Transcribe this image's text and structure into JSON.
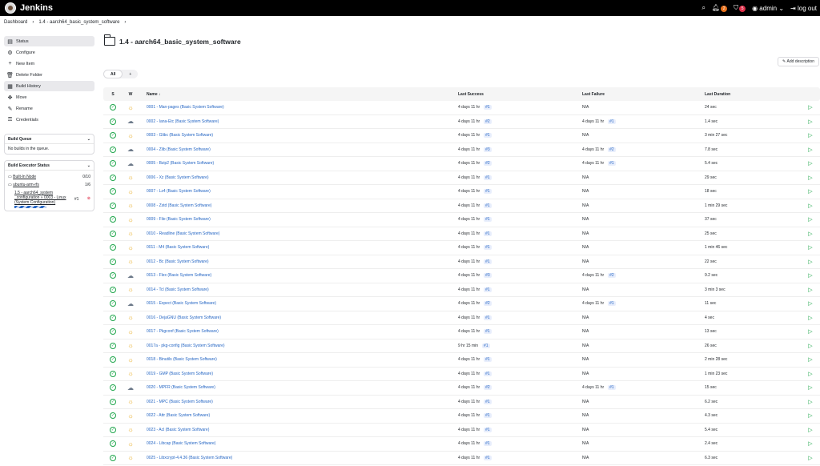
{
  "header": {
    "brand": "Jenkins",
    "notifications_count": "2",
    "security_count": "5",
    "user": "admin",
    "logout": "log out"
  },
  "breadcrumb": [
    "Dashboard",
    "1.4 - aarch64_basic_system_software"
  ],
  "sidebar": {
    "items": [
      {
        "label": "Status",
        "icon": "status-icon"
      },
      {
        "label": "Configure",
        "icon": "gear-icon"
      },
      {
        "label": "New Item",
        "icon": "plus-icon"
      },
      {
        "label": "Delete Folder",
        "icon": "trash-icon"
      },
      {
        "label": "Build History",
        "icon": "history-icon"
      },
      {
        "label": "Move",
        "icon": "move-icon"
      },
      {
        "label": "Rename",
        "icon": "pencil-icon"
      },
      {
        "label": "Credentials",
        "icon": "key-icon"
      }
    ],
    "build_queue": {
      "title": "Build Queue",
      "empty": "No builds in the queue."
    },
    "executor": {
      "title": "Build Executor Status",
      "nodes": [
        {
          "name": "Built-In Node",
          "count": "0/10"
        },
        {
          "name": "ubuntu-arm-rfs",
          "count": "1/6"
        }
      ],
      "job_line1": "1.5 - aarch64_system",
      "job_line2": "_configuration » 0003 - Linux",
      "job_line3": "(System Configuration)",
      "job_num": "#1"
    }
  },
  "main": {
    "title": "1.4 - aarch64_basic_system_software",
    "add_description": "Add description",
    "tabs": [
      "All",
      "+"
    ],
    "columns": {
      "s": "S",
      "w": "W",
      "name": "Name ↓",
      "last_success": "Last Success",
      "last_failure": "Last Failure",
      "last_duration": "Last Duration"
    },
    "rows": [
      {
        "name": "0001 - Man-pages (Basic System Software)",
        "weather": "sun",
        "succ": "4 days 11 hr",
        "succ_num": "#1",
        "fail": "N/A",
        "fail_num": "",
        "dur": "24 sec"
      },
      {
        "name": "0002 - Iana-Etc (Basic System Software)",
        "weather": "cloud",
        "succ": "4 days 11 hr",
        "succ_num": "#2",
        "fail": "4 days 11 hr",
        "fail_num": "#1",
        "dur": "1.4 sec"
      },
      {
        "name": "0003 - Glibc (Basic System Software)",
        "weather": "sun",
        "succ": "4 days 11 hr",
        "succ_num": "#1",
        "fail": "N/A",
        "fail_num": "",
        "dur": "3 min 27 sec"
      },
      {
        "name": "0004 - Zlib (Basic System Software)",
        "weather": "cloud",
        "succ": "4 days 11 hr",
        "succ_num": "#3",
        "fail": "4 days 11 hr",
        "fail_num": "#2",
        "dur": "7.8 sec"
      },
      {
        "name": "0005 - Bzip2 (Basic System Software)",
        "weather": "cloud",
        "succ": "4 days 11 hr",
        "succ_num": "#2",
        "fail": "4 days 11 hr",
        "fail_num": "#1",
        "dur": "5.4 sec"
      },
      {
        "name": "0006 - Xz (Basic System Software)",
        "weather": "sun",
        "succ": "4 days 11 hr",
        "succ_num": "#1",
        "fail": "N/A",
        "fail_num": "",
        "dur": "29 sec"
      },
      {
        "name": "0007 - Lz4 (Basic System Software)",
        "weather": "sun",
        "succ": "4 days 11 hr",
        "succ_num": "#1",
        "fail": "N/A",
        "fail_num": "",
        "dur": "18 sec"
      },
      {
        "name": "0008 - Zstd (Basic System Software)",
        "weather": "sun",
        "succ": "4 days 11 hr",
        "succ_num": "#1",
        "fail": "N/A",
        "fail_num": "",
        "dur": "1 min 29 sec"
      },
      {
        "name": "0009 - File (Basic System Software)",
        "weather": "sun",
        "succ": "4 days 11 hr",
        "succ_num": "#1",
        "fail": "N/A",
        "fail_num": "",
        "dur": "37 sec"
      },
      {
        "name": "0010 - Readline (Basic System Software)",
        "weather": "sun",
        "succ": "4 days 11 hr",
        "succ_num": "#1",
        "fail": "N/A",
        "fail_num": "",
        "dur": "25 sec"
      },
      {
        "name": "0011 - M4 (Basic System Software)",
        "weather": "sun",
        "succ": "4 days 11 hr",
        "succ_num": "#1",
        "fail": "N/A",
        "fail_num": "",
        "dur": "1 min 46 sec"
      },
      {
        "name": "0012 - Bc (Basic System Software)",
        "weather": "sun",
        "succ": "4 days 11 hr",
        "succ_num": "#1",
        "fail": "N/A",
        "fail_num": "",
        "dur": "22 sec"
      },
      {
        "name": "0013 - Flex (Basic System Software)",
        "weather": "cloud",
        "succ": "4 days 11 hr",
        "succ_num": "#3",
        "fail": "4 days 11 hr",
        "fail_num": "#2",
        "dur": "9.2 sec"
      },
      {
        "name": "0014 - Tcl (Basic System Software)",
        "weather": "sun",
        "succ": "4 days 11 hr",
        "succ_num": "#1",
        "fail": "N/A",
        "fail_num": "",
        "dur": "3 min 3 sec"
      },
      {
        "name": "0015 - Expect (Basic System Software)",
        "weather": "cloud",
        "succ": "4 days 11 hr",
        "succ_num": "#2",
        "fail": "4 days 11 hr",
        "fail_num": "#1",
        "dur": "11 sec"
      },
      {
        "name": "0016 - DejaGNU (Basic System Software)",
        "weather": "sun",
        "succ": "4 days 11 hr",
        "succ_num": "#1",
        "fail": "N/A",
        "fail_num": "",
        "dur": "4 sec"
      },
      {
        "name": "0017 - Pkgconf (Basic System Software)",
        "weather": "sun",
        "succ": "4 days 11 hr",
        "succ_num": "#1",
        "fail": "N/A",
        "fail_num": "",
        "dur": "13 sec"
      },
      {
        "name": "0017a - pkg-config (Basic System Software)",
        "weather": "sun",
        "succ": "9 hr 15 min",
        "succ_num": "#1",
        "fail": "N/A",
        "fail_num": "",
        "dur": "26 sec"
      },
      {
        "name": "0018 - Binutils (Basic System Software)",
        "weather": "sun",
        "succ": "4 days 11 hr",
        "succ_num": "#1",
        "fail": "N/A",
        "fail_num": "",
        "dur": "2 min 28 sec"
      },
      {
        "name": "0019 - GMP (Basic System Software)",
        "weather": "sun",
        "succ": "4 days 11 hr",
        "succ_num": "#1",
        "fail": "N/A",
        "fail_num": "",
        "dur": "1 min 23 sec"
      },
      {
        "name": "0020 - MPFR (Basic System Software)",
        "weather": "cloud",
        "succ": "4 days 11 hr",
        "succ_num": "#2",
        "fail": "4 days 11 hr",
        "fail_num": "#1",
        "dur": "15 sec"
      },
      {
        "name": "0021 - MPC (Basic System Software)",
        "weather": "sun",
        "succ": "4 days 11 hr",
        "succ_num": "#1",
        "fail": "N/A",
        "fail_num": "",
        "dur": "6.2 sec"
      },
      {
        "name": "0022 - Attr (Basic System Software)",
        "weather": "sun",
        "succ": "4 days 11 hr",
        "succ_num": "#1",
        "fail": "N/A",
        "fail_num": "",
        "dur": "4.3 sec"
      },
      {
        "name": "0023 - Acl (Basic System Software)",
        "weather": "sun",
        "succ": "4 days 11 hr",
        "succ_num": "#1",
        "fail": "N/A",
        "fail_num": "",
        "dur": "5.4 sec"
      },
      {
        "name": "0024 - Libcap (Basic System Software)",
        "weather": "sun",
        "succ": "4 days 11 hr",
        "succ_num": "#1",
        "fail": "N/A",
        "fail_num": "",
        "dur": "2.4 sec"
      },
      {
        "name": "0025 - Libxcrypt-4.4.36 (Basic System Software)",
        "weather": "sun",
        "succ": "4 days 11 hr",
        "succ_num": "#1",
        "fail": "N/A",
        "fail_num": "",
        "dur": "6.3 sec"
      }
    ]
  }
}
